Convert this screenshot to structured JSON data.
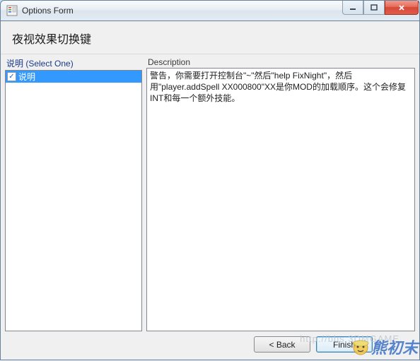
{
  "window": {
    "title": "Options Form"
  },
  "heading": "夜视效果切换键",
  "left": {
    "label": "说明 (Select One)",
    "items": [
      {
        "label": "说明",
        "checked": true,
        "selected": true
      }
    ]
  },
  "right": {
    "label": "Description",
    "text": "警告，你需要打开控制台\"~\"然后\"help FixNight\"，然后\n用\"player.addSpell XX000800\"XX是你MOD的加载顺序。这个会修复INT和每一个额外技能。"
  },
  "buttons": {
    "back": "< Back",
    "finish": "Finish"
  },
  "watermark": {
    "url": "http://bbs 3DMGAME",
    "text": "熊初末"
  }
}
